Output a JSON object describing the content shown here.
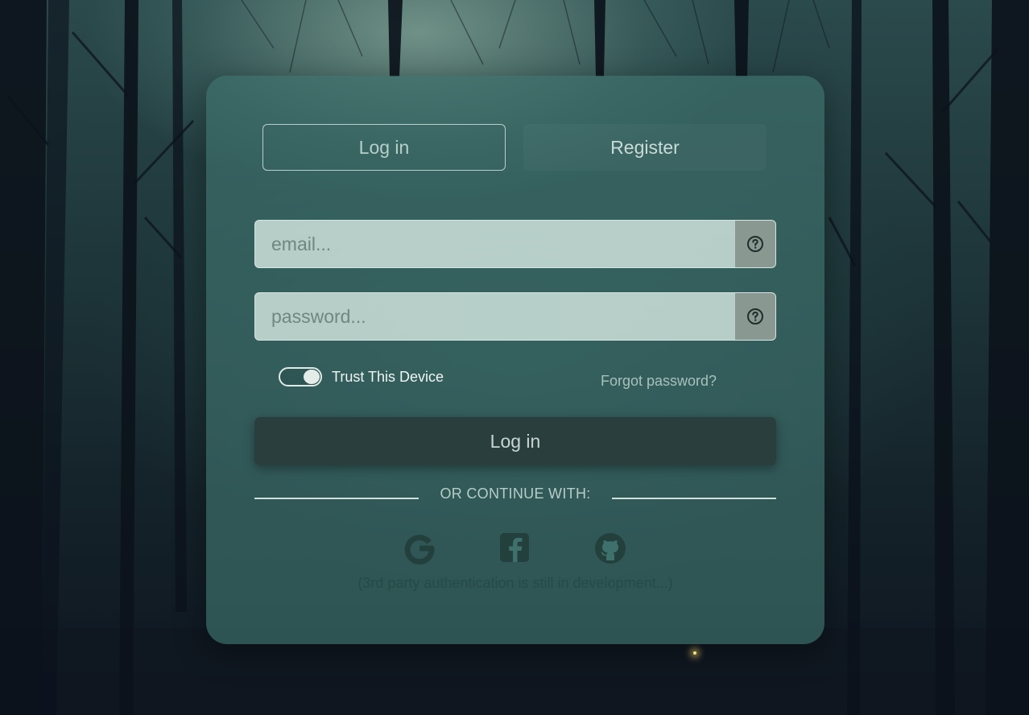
{
  "tabs": [
    {
      "label": "Log in",
      "active": true
    },
    {
      "label": "Register",
      "active": false
    }
  ],
  "email": {
    "placeholder": "email...",
    "value": ""
  },
  "password": {
    "placeholder": "password...",
    "value": ""
  },
  "trust_label": "Trust This Device",
  "trust_enabled": true,
  "forgot_label": "Forgot password?",
  "login_label": "Log in",
  "divider_text": "OR CONTINUE WITH:",
  "social": [
    {
      "icon": "google-icon"
    },
    {
      "icon": "facebook-icon"
    },
    {
      "icon": "github-icon"
    }
  ],
  "note": "(3rd party authentication is still in development...)",
  "colors": {
    "card": "#3e706c",
    "button": "#2a3e3d",
    "field": "#cde2db",
    "icon": "#23403d"
  }
}
